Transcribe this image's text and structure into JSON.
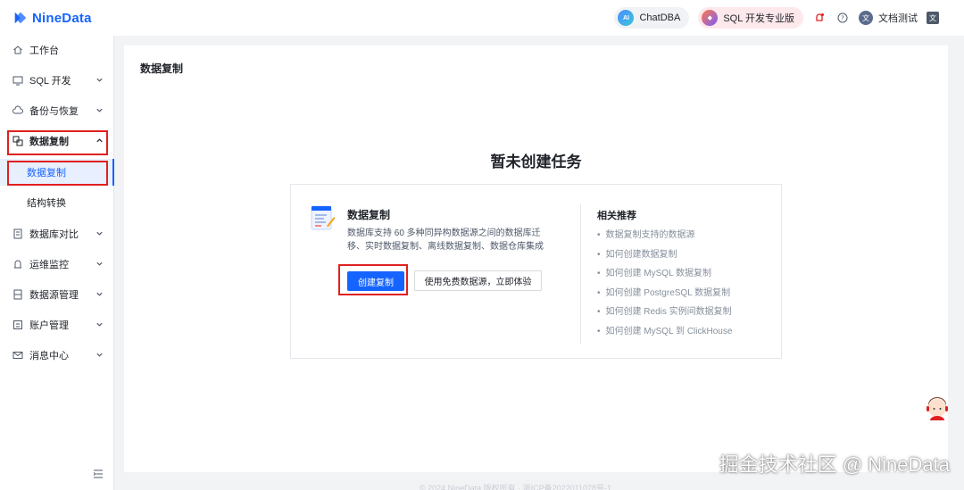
{
  "app": {
    "name": "NineData",
    "brand_color": "#1664ff"
  },
  "topbar": {
    "chatdba_label": "ChatDBA",
    "chatdba_icon_text": "AI",
    "sql_label": "SQL 开发专业版",
    "user_name": "文档测试",
    "user_avatar_text": "文"
  },
  "sidebar": {
    "items": [
      {
        "label": "工作台",
        "icon": "home-icon"
      },
      {
        "label": "SQL 开发",
        "icon": "terminal-icon"
      },
      {
        "label": "备份与恢复",
        "icon": "cloud-backup-icon"
      },
      {
        "label": "数据复制",
        "icon": "copy-icon"
      },
      {
        "label": "数据库对比",
        "icon": "compare-icon"
      },
      {
        "label": "运维监控",
        "icon": "monitor-icon"
      },
      {
        "label": "数据源管理",
        "icon": "database-icon"
      },
      {
        "label": "账户管理",
        "icon": "account-icon"
      },
      {
        "label": "消息中心",
        "icon": "mail-icon"
      }
    ],
    "sub_items": [
      {
        "label": "数据复制",
        "active": true
      },
      {
        "label": "结构转换",
        "active": false
      }
    ]
  },
  "main": {
    "page_title": "数据复制",
    "empty_title": "暂未创建任务",
    "card": {
      "title": "数据复制",
      "description": "数据库支持 60 多种同异构数据源之间的数据库迁移、实时数据复制、离线数据复制、数据仓库集成",
      "primary_button": "创建复制",
      "secondary_button": "使用免费数据源，立即体验"
    },
    "recommend": {
      "title": "相关推荐",
      "items": [
        "数据复制支持的数据源",
        "如何创建数据复制",
        "如何创建 MySQL 数据复制",
        "如何创建 PostgreSQL 数据复制",
        "如何创建 Redis 实例间数据复制",
        "如何创建 MySQL 到 ClickHouse"
      ]
    }
  },
  "footer": {
    "text": "© 2024 NineData 版权所有 · 浙ICP备2022011078号-1"
  },
  "watermark": "掘金技术社区 @ NineData",
  "colors": {
    "highlight_box": "#e02020",
    "active_bg": "#e8f0ff"
  }
}
